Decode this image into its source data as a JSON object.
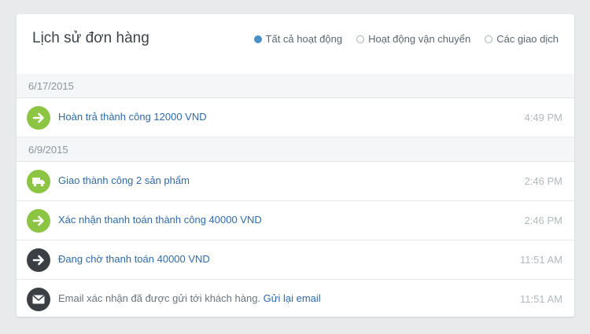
{
  "title": "Lịch sử đơn hàng",
  "filters": [
    {
      "label": "Tất cả hoạt động",
      "active": true
    },
    {
      "label": "Hoạt động vận chuyển",
      "active": false
    },
    {
      "label": "Các giao dịch",
      "active": false
    }
  ],
  "groups": [
    {
      "date": "6/17/2015",
      "events": [
        {
          "icon": "arrow-right-icon",
          "text": "Hoàn trả thành công 12000 VND",
          "time": "4:49 PM"
        }
      ]
    },
    {
      "date": "6/9/2015",
      "events": [
        {
          "icon": "truck-icon",
          "text": "Giao thành công 2 sản phẩm",
          "time": "2:46 PM"
        },
        {
          "icon": "arrow-right-icon",
          "text": "Xác nhận thanh toán thành công 40000 VND",
          "time": "2:46 PM"
        },
        {
          "icon": "arrow-right-icon",
          "text": "Đang chờ thanh toán 40000 VND",
          "time": "11:51 AM"
        },
        {
          "icon": "envelope-icon",
          "text": "Email xác nhận đã được gửi tới khách hàng.",
          "link": "Gửi lại email",
          "time": "11:51 AM"
        }
      ]
    }
  ],
  "colors": {
    "green": "#8cc443",
    "dark": "#3b3f44",
    "link": "#2f6aa8",
    "accent": "#4a90c8"
  }
}
